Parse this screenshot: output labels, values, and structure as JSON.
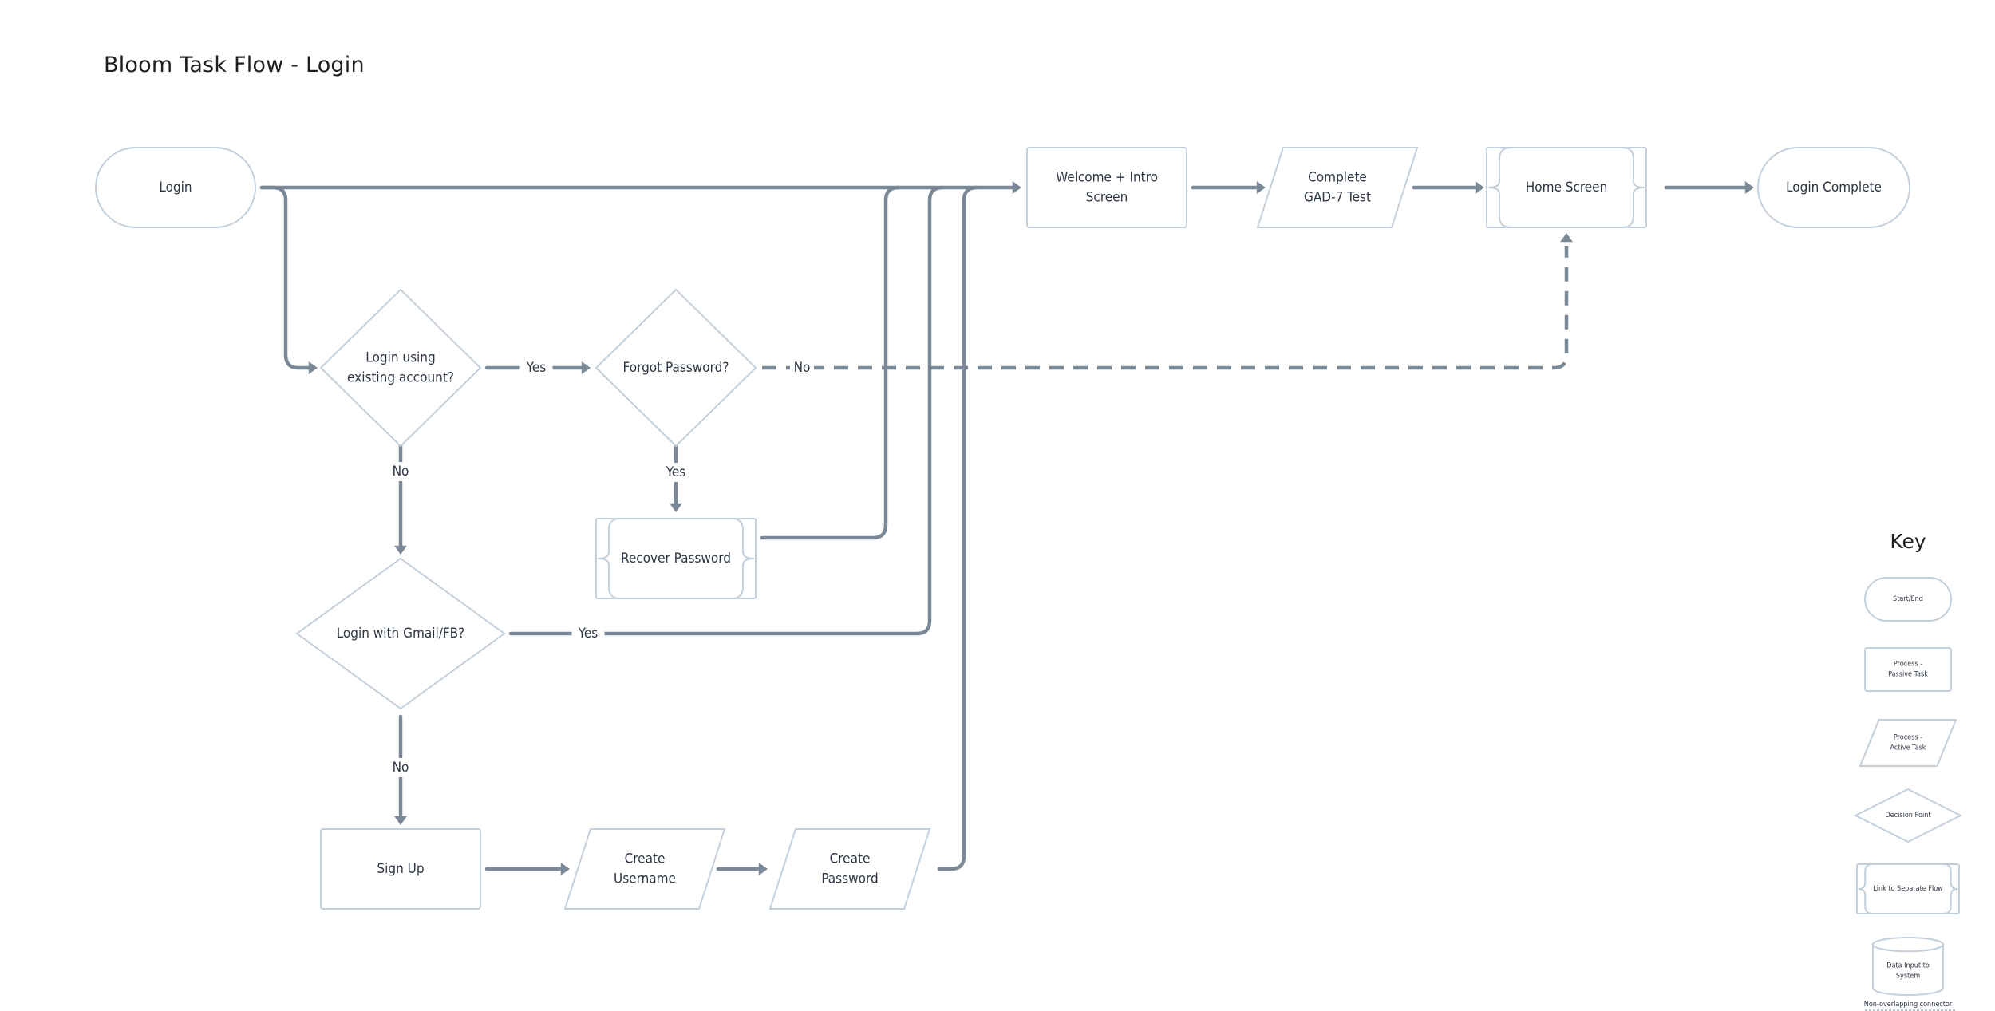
{
  "title": "Bloom Task Flow - Login",
  "colors": {
    "connector": "#7b8898",
    "node_border": "#c3cfdb",
    "text": "#2d3644",
    "background": "#ffffff"
  },
  "nodes": {
    "login": {
      "type": "start-end",
      "lines": [
        "Login"
      ]
    },
    "welcome": {
      "type": "process-passive",
      "lines": [
        "Welcome + Intro",
        "Screen"
      ]
    },
    "gad7": {
      "type": "process-active",
      "lines": [
        "Complete",
        "GAD-7 Test"
      ]
    },
    "home": {
      "type": "link-separate-flow",
      "lines": [
        "Home Screen"
      ]
    },
    "login_complete": {
      "type": "start-end",
      "lines": [
        "Login Complete"
      ]
    },
    "existing_account": {
      "type": "decision",
      "lines": [
        "Login using",
        "existing account?"
      ]
    },
    "forgot_password": {
      "type": "decision",
      "lines": [
        "Forgot Password?"
      ]
    },
    "recover_password": {
      "type": "link-separate-flow",
      "lines": [
        "Recover Password"
      ]
    },
    "gmail_fb": {
      "type": "decision",
      "lines": [
        "Login with Gmail/FB?"
      ]
    },
    "sign_up": {
      "type": "process-passive",
      "lines": [
        "Sign Up"
      ]
    },
    "create_username": {
      "type": "process-active",
      "lines": [
        "Create",
        "Username"
      ]
    },
    "create_password": {
      "type": "process-active",
      "lines": [
        "Create",
        "Password"
      ]
    }
  },
  "edges": [
    {
      "from": "login",
      "to": "welcome",
      "label": "",
      "style": "solid"
    },
    {
      "from": "login",
      "to": "existing_account",
      "label": "",
      "style": "solid"
    },
    {
      "from": "existing_account",
      "to": "forgot_password",
      "label": "Yes",
      "style": "solid"
    },
    {
      "from": "existing_account",
      "to": "gmail_fb",
      "label": "No",
      "style": "solid"
    },
    {
      "from": "forgot_password",
      "to": "home",
      "label": "No",
      "style": "dashed"
    },
    {
      "from": "forgot_password",
      "to": "recover_password",
      "label": "Yes",
      "style": "solid"
    },
    {
      "from": "recover_password",
      "to": "welcome",
      "label": "",
      "style": "solid"
    },
    {
      "from": "gmail_fb",
      "to": "welcome",
      "label": "Yes",
      "style": "solid"
    },
    {
      "from": "gmail_fb",
      "to": "sign_up",
      "label": "No",
      "style": "solid"
    },
    {
      "from": "sign_up",
      "to": "create_username",
      "label": "",
      "style": "solid"
    },
    {
      "from": "create_username",
      "to": "create_password",
      "label": "",
      "style": "solid"
    },
    {
      "from": "create_password",
      "to": "welcome",
      "label": "",
      "style": "solid"
    },
    {
      "from": "welcome",
      "to": "gad7",
      "label": "",
      "style": "solid"
    },
    {
      "from": "gad7",
      "to": "home",
      "label": "",
      "style": "solid"
    },
    {
      "from": "home",
      "to": "login_complete",
      "label": "",
      "style": "solid"
    }
  ],
  "key": {
    "title": "Key",
    "items": [
      {
        "type": "start-end",
        "lines": [
          "Start/End"
        ]
      },
      {
        "type": "process-passive",
        "lines": [
          "Process -",
          "Passive Task"
        ]
      },
      {
        "type": "process-active",
        "lines": [
          "Process -",
          "Active Task"
        ]
      },
      {
        "type": "decision",
        "lines": [
          "Decision Point"
        ]
      },
      {
        "type": "link-separate-flow",
        "lines": [
          "Link to Separate Flow"
        ]
      },
      {
        "type": "data-input",
        "lines": [
          "Data Input to",
          "System"
        ]
      },
      {
        "type": "connector",
        "lines": [
          "Non-overlapping connector"
        ]
      }
    ]
  }
}
